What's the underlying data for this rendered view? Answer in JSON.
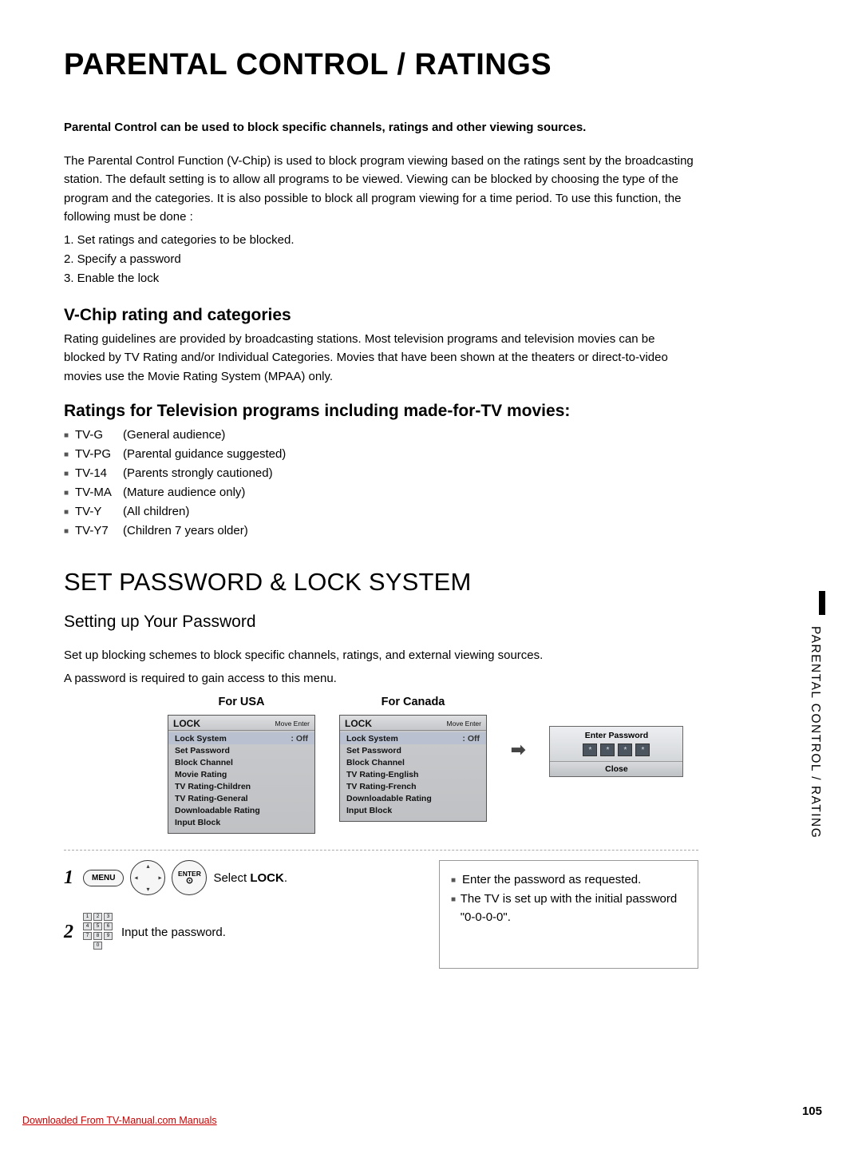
{
  "title": "PARENTAL CONTROL / RATINGS",
  "sideTab": "PARENTAL CONTROL / RATING",
  "intro": "Parental Control can be used to block specific channels, ratings and other viewing sources.",
  "para1": "The Parental Control Function (V-Chip) is used to block program viewing based on the ratings sent by the broadcasting station. The default setting is to allow all programs to be viewed. Viewing can be blocked by choosing the type of the program and the categories. It is also possible to block all program viewing for a time period. To use this function, the following must be done :",
  "steps": {
    "s1": "1. Set ratings and categories to be blocked.",
    "s2": "2. Specify a password",
    "s3": "3. Enable the lock"
  },
  "h2a": "V-Chip rating and categories",
  "para2": "Rating guidelines are provided by broadcasting stations. Most television programs and television movies can be blocked by TV Rating and/or Individual Categories. Movies that have been shown at the theaters or direct-to-video movies use the Movie Rating System (MPAA) only.",
  "h2b": "Ratings for Television programs including made-for-TV movies:",
  "ratings": [
    {
      "code": "TV-G",
      "desc": "(General audience)"
    },
    {
      "code": "TV-PG",
      "desc": "(Parental guidance suggested)"
    },
    {
      "code": "TV-14",
      "desc": "(Parents strongly cautioned)"
    },
    {
      "code": "TV-MA",
      "desc": "(Mature audience only)"
    },
    {
      "code": "TV-Y",
      "desc": "(All children)"
    },
    {
      "code": "TV-Y7",
      "desc": "(Children 7 years older)"
    }
  ],
  "h1b": "SET PASSWORD & LOCK SYSTEM",
  "h3": "Setting up Your Password",
  "para3a": "Set up blocking schemes to block specific channels, ratings, and external viewing sources.",
  "para3b": "A password is required to gain access to this menu.",
  "menus": {
    "usa": {
      "caption": "For USA",
      "title": "LOCK",
      "hint": "Move      Enter",
      "items": [
        {
          "k": "Lock System",
          "v": ": Off"
        },
        {
          "k": "Set Password",
          "v": ""
        },
        {
          "k": "Block Channel",
          "v": ""
        },
        {
          "k": "Movie Rating",
          "v": ""
        },
        {
          "k": "TV Rating-Children",
          "v": ""
        },
        {
          "k": "TV Rating-General",
          "v": ""
        },
        {
          "k": "Downloadable Rating",
          "v": ""
        },
        {
          "k": "Input Block",
          "v": ""
        }
      ]
    },
    "canada": {
      "caption": "For Canada",
      "title": "LOCK",
      "hint": "Move      Enter",
      "items": [
        {
          "k": "Lock System",
          "v": ": Off"
        },
        {
          "k": "Set Password",
          "v": ""
        },
        {
          "k": "Block Channel",
          "v": ""
        },
        {
          "k": "TV Rating-English",
          "v": ""
        },
        {
          "k": "TV Rating-French",
          "v": ""
        },
        {
          "k": "Downloadable Rating",
          "v": ""
        },
        {
          "k": "Input Block",
          "v": ""
        }
      ]
    },
    "pwbox": {
      "title": "Enter Password",
      "mask": "*",
      "close": "Close"
    }
  },
  "proc": {
    "n1": "1",
    "n2": "2",
    "menuBtn": "MENU",
    "enterBtn": "ENTER",
    "t1a": "Select ",
    "t1b": "LOCK",
    "t1c": ".",
    "t2": "Input the password."
  },
  "notes": {
    "a": "Enter the password as requested.",
    "b": "The TV is set up with the initial password \"0-0-0-0\"."
  },
  "pageNum": "105",
  "download": "Downloaded From TV-Manual.com Manuals"
}
